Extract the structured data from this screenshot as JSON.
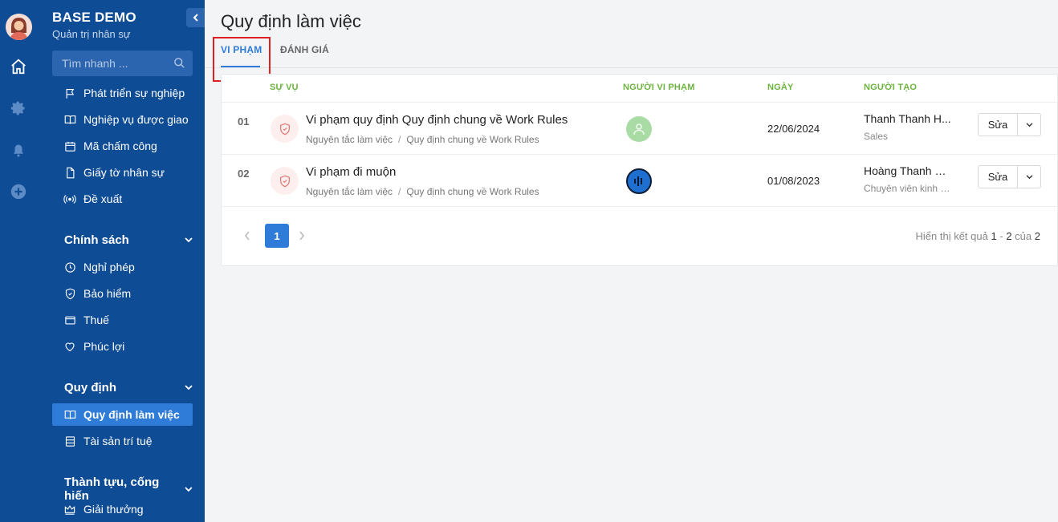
{
  "app": {
    "name": "BASE DEMO",
    "subtitle": "Quản trị nhân sự"
  },
  "search": {
    "placeholder": "Tìm nhanh ..."
  },
  "sidebar": {
    "items": [
      {
        "label": "Phát triển sự nghiệp",
        "icon": "flag-icon"
      },
      {
        "label": "Nghiệp vụ được giao",
        "icon": "book-icon"
      },
      {
        "label": "Mã chấm công",
        "icon": "calendar-icon"
      },
      {
        "label": "Giấy tờ nhân sự",
        "icon": "document-icon"
      },
      {
        "label": "Đề xuất",
        "icon": "broadcast-icon"
      }
    ],
    "sections": [
      {
        "title": "Chính sách",
        "items": [
          {
            "label": "Nghỉ phép",
            "icon": "clock-icon"
          },
          {
            "label": "Bảo hiểm",
            "icon": "shield-icon"
          },
          {
            "label": "Thuế",
            "icon": "receipt-icon"
          },
          {
            "label": "Phúc lợi",
            "icon": "heart-icon"
          }
        ]
      },
      {
        "title": "Quy định",
        "items": [
          {
            "label": "Quy định làm việc",
            "icon": "open-book-icon",
            "active": true
          },
          {
            "label": "Tài sản trí tuệ",
            "icon": "database-icon"
          }
        ]
      },
      {
        "title": "Thành tựu, cống hiến",
        "items": [
          {
            "label": "Giải thưởng",
            "icon": "crown-icon"
          }
        ]
      }
    ]
  },
  "page": {
    "title": "Quy định làm việc"
  },
  "tabs": [
    {
      "label": "VI PHẠM",
      "active": true
    },
    {
      "label": "ĐÁNH GIÁ",
      "active": false
    }
  ],
  "table": {
    "headers": {
      "case": "SỰ VỤ",
      "violator": "NGƯỜI VI PHẠM",
      "date": "NGÀY",
      "creator": "NGƯỜI TẠO"
    },
    "rows": [
      {
        "index": "01",
        "title": "Vi phạm quy định Quy định chung về Work Rules",
        "crumb1": "Nguyên tắc làm việc",
        "crumb2": "Quy định chung về Work Rules",
        "date": "22/06/2024",
        "creator": "Thanh Thanh H...",
        "creator_role": "Sales",
        "edit_label": "Sửa"
      },
      {
        "index": "02",
        "title": "Vi phạm đi muộn",
        "crumb1": "Nguyên tắc làm việc",
        "crumb2": "Quy định chung về Work Rules",
        "date": "01/08/2023",
        "creator": "Hoàng Thanh N...",
        "creator_role": "Chuyên viên kinh d...",
        "edit_label": "Sửa"
      }
    ]
  },
  "pagination": {
    "current": "1",
    "result_prefix": "Hiển thị kết quả",
    "from": "1",
    "dash": "-",
    "to": "2",
    "of": "của",
    "total": "2"
  },
  "colors": {
    "sidebar": "#0f4c96",
    "accent": "#2e7bd8",
    "header_green": "#6cb33f",
    "highlight": "#e02020"
  }
}
